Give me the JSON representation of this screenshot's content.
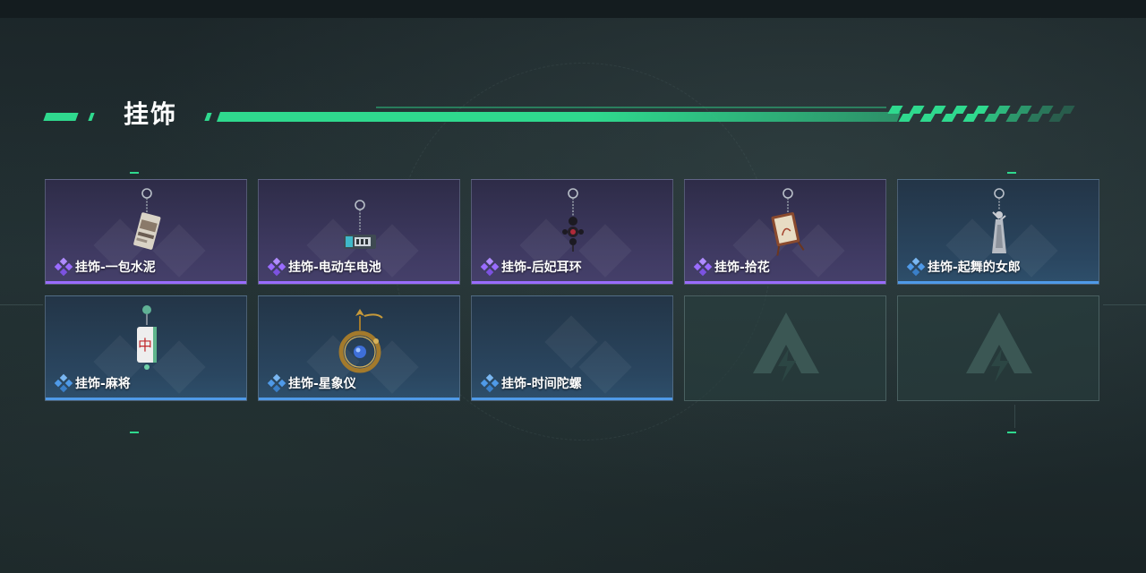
{
  "section": {
    "title": "挂饰"
  },
  "colors": {
    "accent": "#2fd98e",
    "rarity_purple": "#9a6cff",
    "rarity_blue": "#4f9ae8"
  },
  "items": [
    {
      "name": "挂饰-一包水泥",
      "rarity": "purple",
      "icon": "cement-bag-charm-icon"
    },
    {
      "name": "挂饰-电动车电池",
      "rarity": "purple",
      "icon": "ebike-battery-charm-icon"
    },
    {
      "name": "挂饰-后妃耳环",
      "rarity": "purple",
      "icon": "consort-earring-charm-icon"
    },
    {
      "name": "挂饰-拾花",
      "rarity": "purple",
      "icon": "picked-flower-frame-charm-icon"
    },
    {
      "name": "挂饰-起舞的女郎",
      "rarity": "blue",
      "icon": "dancing-lady-charm-icon"
    },
    {
      "name": "挂饰-麻将",
      "rarity": "blue",
      "icon": "mahjong-tile-charm-icon"
    },
    {
      "name": "挂饰-星象仪",
      "rarity": "blue",
      "icon": "astrolabe-charm-icon"
    },
    {
      "name": "挂饰-时间陀螺",
      "rarity": "blue",
      "icon": "time-gyro-charm-icon"
    }
  ],
  "empty_slots": [
    {
      "icon": "empty-slot-logo-icon"
    },
    {
      "icon": "empty-slot-logo-icon"
    }
  ]
}
